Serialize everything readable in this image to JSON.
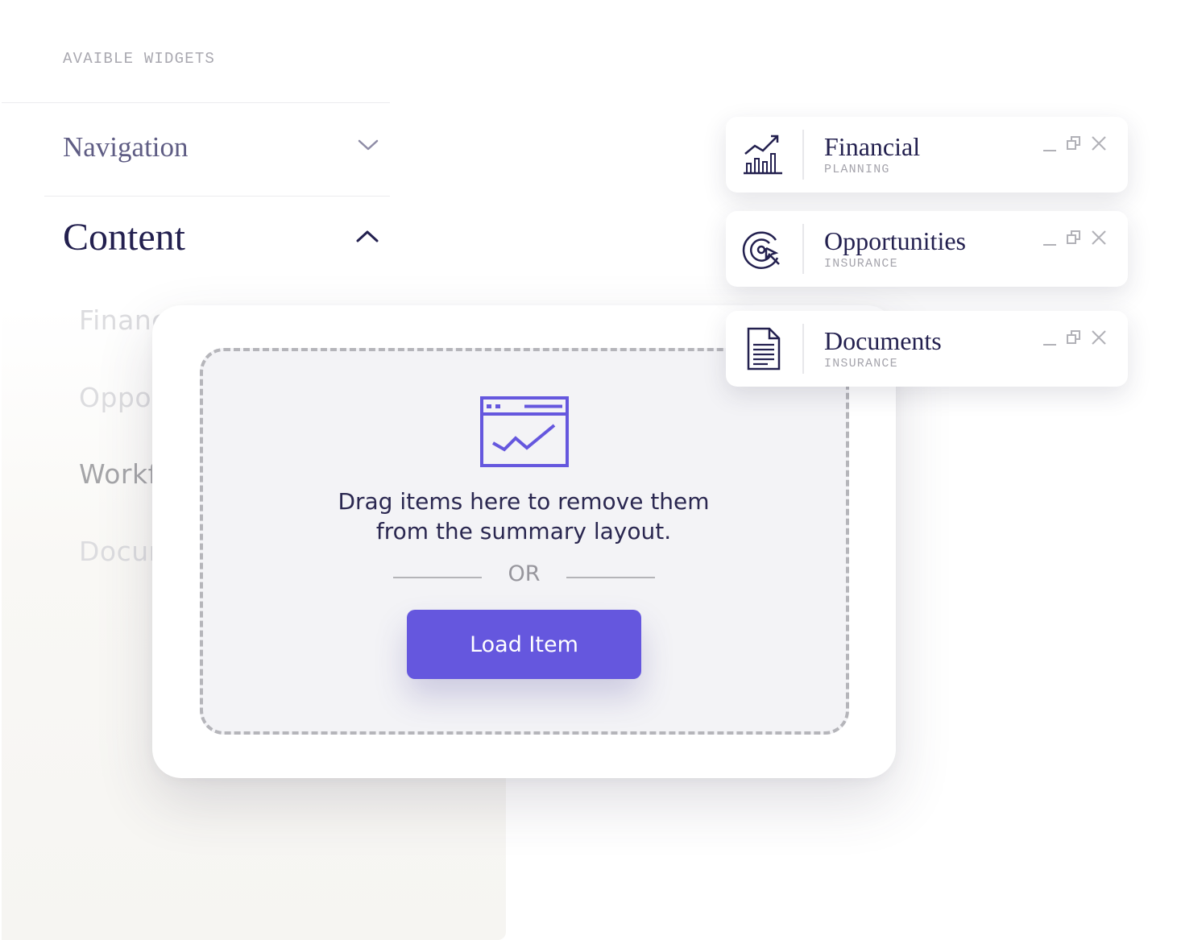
{
  "sidebar": {
    "section_label": "AVAIBLE WIDGETS",
    "accordions": [
      {
        "label": "Navigation",
        "state": "collapsed",
        "icon": "chevron-down-icon"
      },
      {
        "label": "Content",
        "state": "expanded",
        "icon": "chevron-up-icon"
      }
    ],
    "content_items": [
      "Financ",
      "Oppor",
      "Workf",
      "Docur"
    ]
  },
  "drop_zone": {
    "icon": "browser-chart-icon",
    "message_line1": "Drag items here to remove them",
    "message_line2": "from the summary layout.",
    "divider_text": "OR",
    "button_label": "Load Item"
  },
  "widgets": [
    {
      "title": "Financial",
      "subtitle": "PLANNING",
      "icon": "bar-chart-trend-icon"
    },
    {
      "title": "Opportunities",
      "subtitle": "INSURANCE",
      "icon": "target-cursor-icon"
    },
    {
      "title": "Documents",
      "subtitle": "INSURANCE",
      "icon": "document-icon"
    }
  ],
  "colors": {
    "accent": "#6557de",
    "text_dark": "#23204f",
    "text_nav": "#5f5d84",
    "muted": "#a9a8b0"
  }
}
